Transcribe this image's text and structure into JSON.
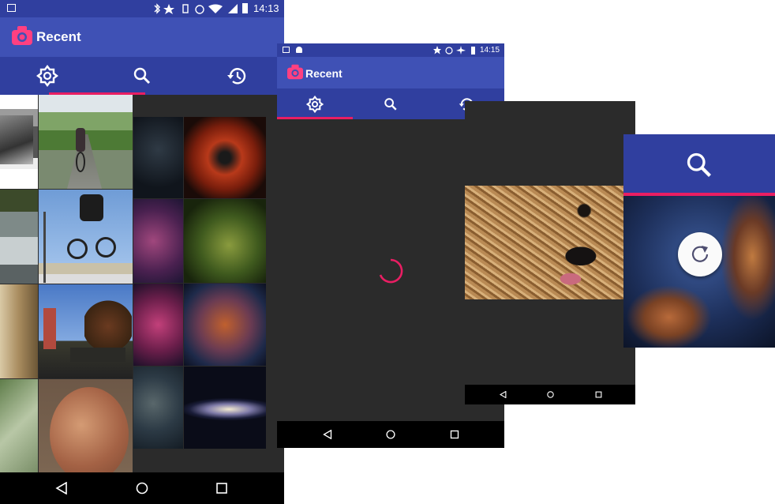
{
  "screen1": {
    "status": {
      "time": "14:13"
    },
    "app_title": "Recent",
    "tabs": [
      {
        "icon": "brightness-icon",
        "selected": true
      },
      {
        "icon": "search-icon",
        "selected": false
      },
      {
        "icon": "history-icon",
        "selected": false
      }
    ],
    "grid_photos": [
      "sports-car-photo",
      "cyclist-road-photo",
      "space-nebula-photo-1",
      "red-nebula-photo",
      "waterfall-photo",
      "bmx-jump-photo",
      "pink-nebula-photo",
      "green-nebula-photo",
      "store-interior-photo",
      "street-trees-photo",
      "magenta-nebula-photo",
      "blue-red-nebula-photo",
      "blurry-green-photo",
      "coin-photo",
      "dark-nebula-photo",
      "galaxy-photo"
    ]
  },
  "screen2": {
    "status": {
      "time": "14:15"
    },
    "app_title": "Recent",
    "tabs": [
      {
        "icon": "brightness-icon",
        "selected": true
      },
      {
        "icon": "search-icon",
        "selected": false
      },
      {
        "icon": "history-icon",
        "selected": false
      }
    ],
    "loading": true
  },
  "screen3": {
    "photo": "dog-closeup-photo"
  },
  "screen4": {
    "tab_icon": "search-icon",
    "photo": "space-nebula-photo-2",
    "overlay_icon": "refresh-icon"
  },
  "colors": {
    "primary": "#3f51b5",
    "primary_dark": "#303f9f",
    "accent": "#e91e63",
    "background": "#2b2b2b"
  }
}
